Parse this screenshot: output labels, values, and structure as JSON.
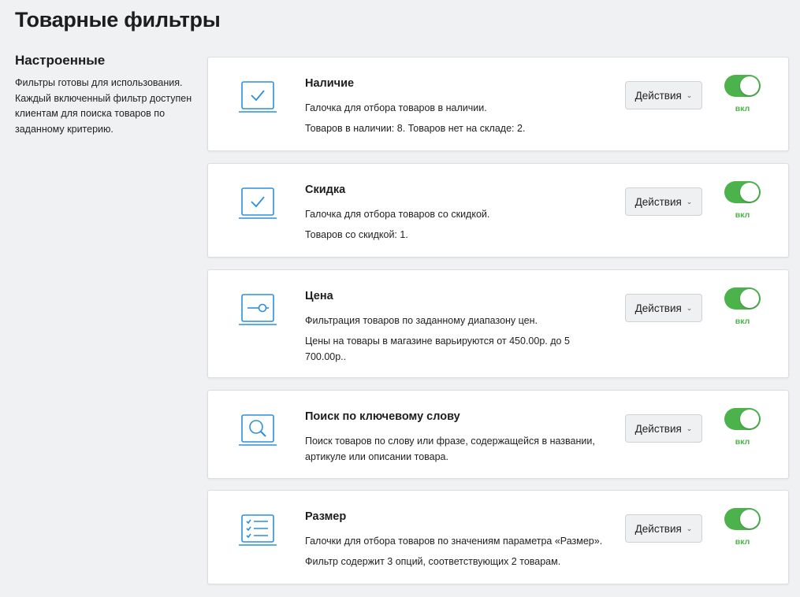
{
  "page": {
    "title": "Товарные фильтры"
  },
  "sidebar": {
    "heading": "Настроенные",
    "description": "Фильтры готовы для использования. Каждый включенный фильтр доступен клиентам для поиска товаров по заданному критерию."
  },
  "colors": {
    "accent": "#2d8fdc",
    "toggle_on": "#4cb34c"
  },
  "filters": [
    {
      "icon": "checkbox-icon",
      "title": "Наличие",
      "desc": "Галочка для отбора товаров в наличии.",
      "info": "Товаров в наличии: 8. Товаров нет на складе: 2.",
      "actions_label": "Действия",
      "toggle_label": "вкл"
    },
    {
      "icon": "checkbox-icon",
      "title": "Скидка",
      "desc": "Галочка для отбора товаров со скидкой.",
      "info": "Товаров со скидкой: 1.",
      "actions_label": "Действия",
      "toggle_label": "вкл"
    },
    {
      "icon": "slider-icon",
      "title": "Цена",
      "desc": "Фильтрация товаров по заданному диапазону цен.",
      "info": "Цены на товары в магазине варьируются от 450.00р. до 5 700.00р..",
      "actions_label": "Действия",
      "toggle_label": "вкл"
    },
    {
      "icon": "search-icon",
      "title": "Поиск по ключевому слову",
      "desc": "Поиск товаров по слову или фразе, содержащейся в названии, артикуле или описании товара.",
      "info": "",
      "actions_label": "Действия",
      "toggle_label": "вкл"
    },
    {
      "icon": "checklist-icon",
      "title": "Размер",
      "desc": "Галочки для отбора товаров по значениям параметра «Размер».",
      "info": "Фильтр содержит 3 опций, соответствующих 2 товарам.",
      "actions_label": "Действия",
      "toggle_label": "вкл"
    }
  ]
}
